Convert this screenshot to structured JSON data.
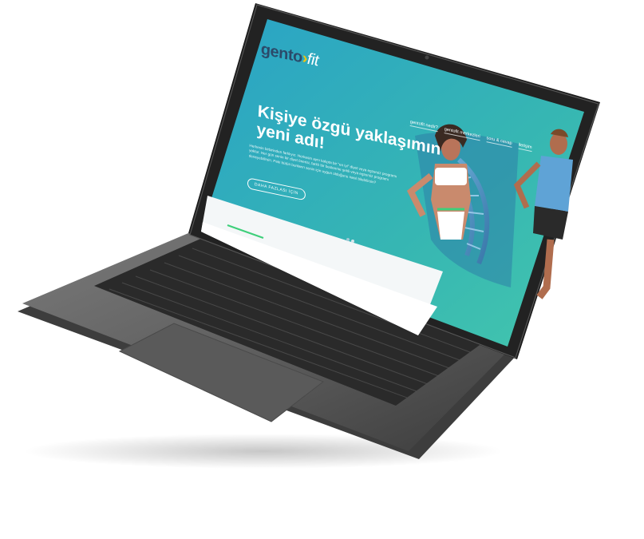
{
  "scene": {
    "description_colors": {
      "laptop_body": "#5c5c5c",
      "laptop_deck": "#6a6a6a",
      "bezel": "#1a1a1a",
      "screen_teal_light": "#3bc1b2",
      "screen_teal_dark": "#2d9fc0",
      "accent_green": "#3ecf7a"
    }
  },
  "website": {
    "logo_main": "gento",
    "logo_arrow": "›",
    "logo_fit": "fit",
    "nav": [
      "gentofit nedir?",
      "gentofit merkezleri",
      "soru & cevap",
      "iletişim"
    ],
    "hero_title": "Kişiye özgü yaklaşımın yeni adı!",
    "hero_body": "Herkesin birbirinden farklıyız. Herkesin aynı kalıpta bir \"en iyi\" diyet veya egzersiz programı yoktur. Her gün senin bir diyet önerisi, farklı bir beslenme şekli veya egzersiz programı deneyebilirsin. Peki bütün bunların senin için uygun olduğunu nasıl bilebilirsin?",
    "cta_label": "DAHA FAZLASI İÇİN"
  }
}
